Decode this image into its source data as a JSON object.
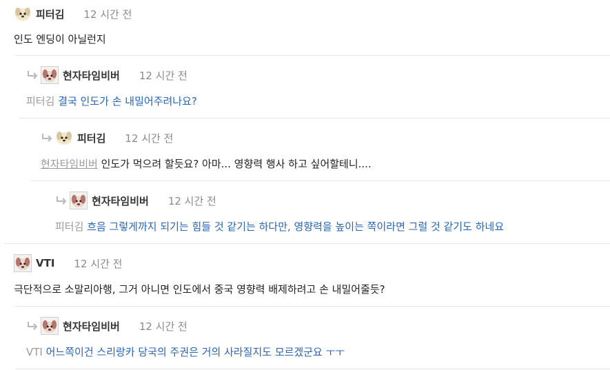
{
  "comments": [
    {
      "author": "피터김",
      "time": "12 시간 전",
      "mention": "",
      "text": "인도 엔딩이 아닐런지"
    },
    {
      "author": "현자타임비버",
      "time": "12 시간 전",
      "mention": "피터김",
      "text": "결국 인도가 손 내밀어주려나요?"
    },
    {
      "author": "피터김",
      "time": "12 시간 전",
      "mention": "현자타임비버",
      "text": "인도가 먹으려 할듯요? 아마... 영향력 행사 하고 싶어할테니...."
    },
    {
      "author": "현자타임비버",
      "time": "12 시간 전",
      "mention": "피터김",
      "text": "흐음 그렇게까지 되기는 힘들 것 같기는 하다만, 영향력을 높이는 쪽이라면 그럴 것 같기도 하네요"
    },
    {
      "author": "VTI",
      "time": "12 시간 전",
      "mention": "",
      "text": "극단적으로 소말리아행, 그거 아니면 인도에서 중국 영향력 배제하려고 손 내밀어줄듯?"
    },
    {
      "author": "현자타임비버",
      "time": "12 시간 전",
      "mention": "VTI",
      "text": "어느쪽이건 스리랑카 당국의 주권은 거의 사라질지도 모르겠군요 ㅜㅜ"
    }
  ],
  "icons": {
    "reply": "reply-arrow-icon",
    "avatar": "avatar-icon"
  },
  "colors": {
    "link": "#2566b8",
    "mention": "#9a9a9a",
    "time": "#8a8a8a"
  }
}
